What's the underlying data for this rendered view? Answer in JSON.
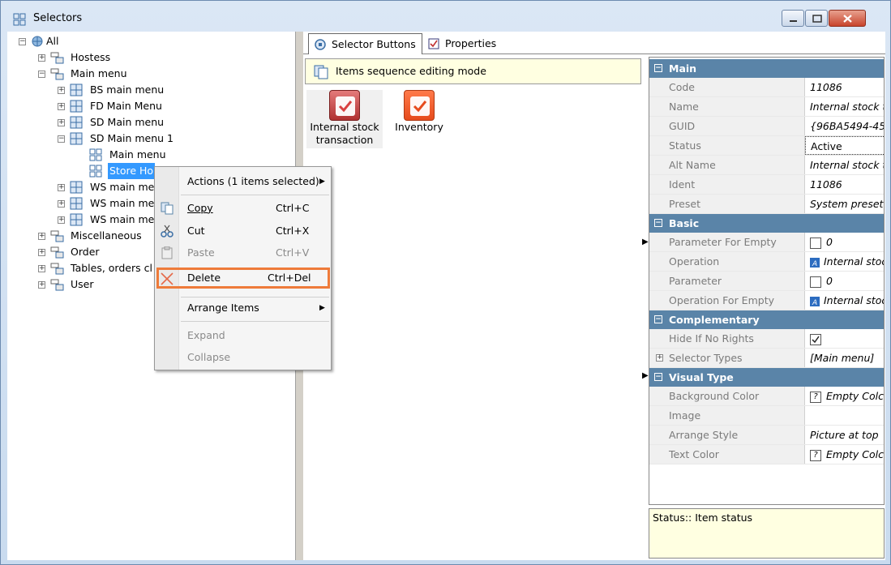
{
  "window": {
    "title": "Selectors"
  },
  "tree": {
    "root": "All",
    "nodes": [
      {
        "label": "Hostess"
      },
      {
        "label": "Main menu"
      },
      {
        "label": "BS main menu"
      },
      {
        "label": "FD Main Menu"
      },
      {
        "label": "SD Main menu"
      },
      {
        "label": "SD Main menu 1"
      },
      {
        "label": "Main menu"
      },
      {
        "label": "Store Ho"
      },
      {
        "label": "WS main me"
      },
      {
        "label": "WS main me"
      },
      {
        "label": "WS main me"
      },
      {
        "label": "Miscellaneous"
      },
      {
        "label": "Order"
      },
      {
        "label": "Tables, orders cl"
      },
      {
        "label": "User"
      }
    ]
  },
  "context_menu": {
    "actions": "Actions (1 items selected)",
    "copy": {
      "label": "Copy",
      "shortcut": "Ctrl+C"
    },
    "cut": {
      "label": "Cut",
      "shortcut": "Ctrl+X"
    },
    "paste": {
      "label": "Paste",
      "shortcut": "Ctrl+V"
    },
    "delete": {
      "label": "Delete",
      "shortcut": "Ctrl+Del"
    },
    "arrange": "Arrange Items",
    "expand": "Expand",
    "collapse": "Collapse"
  },
  "tabs": [
    {
      "label": "Selector Buttons"
    },
    {
      "label": "Properties"
    }
  ],
  "hint": "Items sequence editing mode",
  "items": [
    {
      "label_line1": "Internal stock",
      "label_line2": "transaction"
    },
    {
      "label_line1": "Inventory",
      "label_line2": ""
    }
  ],
  "properties": {
    "main": {
      "title": "Main",
      "rows": [
        {
          "name": "Code",
          "value": "11086"
        },
        {
          "name": "Name",
          "value": "Internal stock t"
        },
        {
          "name": "GUID",
          "value": "{96BA5494-45"
        },
        {
          "name": "Status",
          "value": "Active"
        },
        {
          "name": "Alt Name",
          "value": "Internal stock t"
        },
        {
          "name": "Ident",
          "value": "11086"
        },
        {
          "name": "Preset",
          "value": "System preset"
        }
      ]
    },
    "basic": {
      "title": "Basic",
      "rows": [
        {
          "name": "Parameter For Empty",
          "value": "0"
        },
        {
          "name": "Operation",
          "value": "Internal stoc"
        },
        {
          "name": "Parameter",
          "value": "0"
        },
        {
          "name": "Operation For Empty",
          "value": "Internal stoc"
        }
      ]
    },
    "complementary": {
      "title": "Complementary",
      "rows": [
        {
          "name": "Hide If No Rights",
          "value": ""
        },
        {
          "name": "Selector Types",
          "value": "[Main menu]"
        }
      ]
    },
    "visual": {
      "title": "Visual Type",
      "rows": [
        {
          "name": "Background Color",
          "value": "Empty Colc"
        },
        {
          "name": "Image",
          "value": ""
        },
        {
          "name": "Arrange Style",
          "value": "Picture at top"
        },
        {
          "name": "Text Color",
          "value": "Empty Colc"
        }
      ]
    }
  },
  "status": "Status:: Item status",
  "colors": {
    "accent": "#5a84a8",
    "highlight": "#ee7b3a",
    "selection": "#3399ff"
  }
}
